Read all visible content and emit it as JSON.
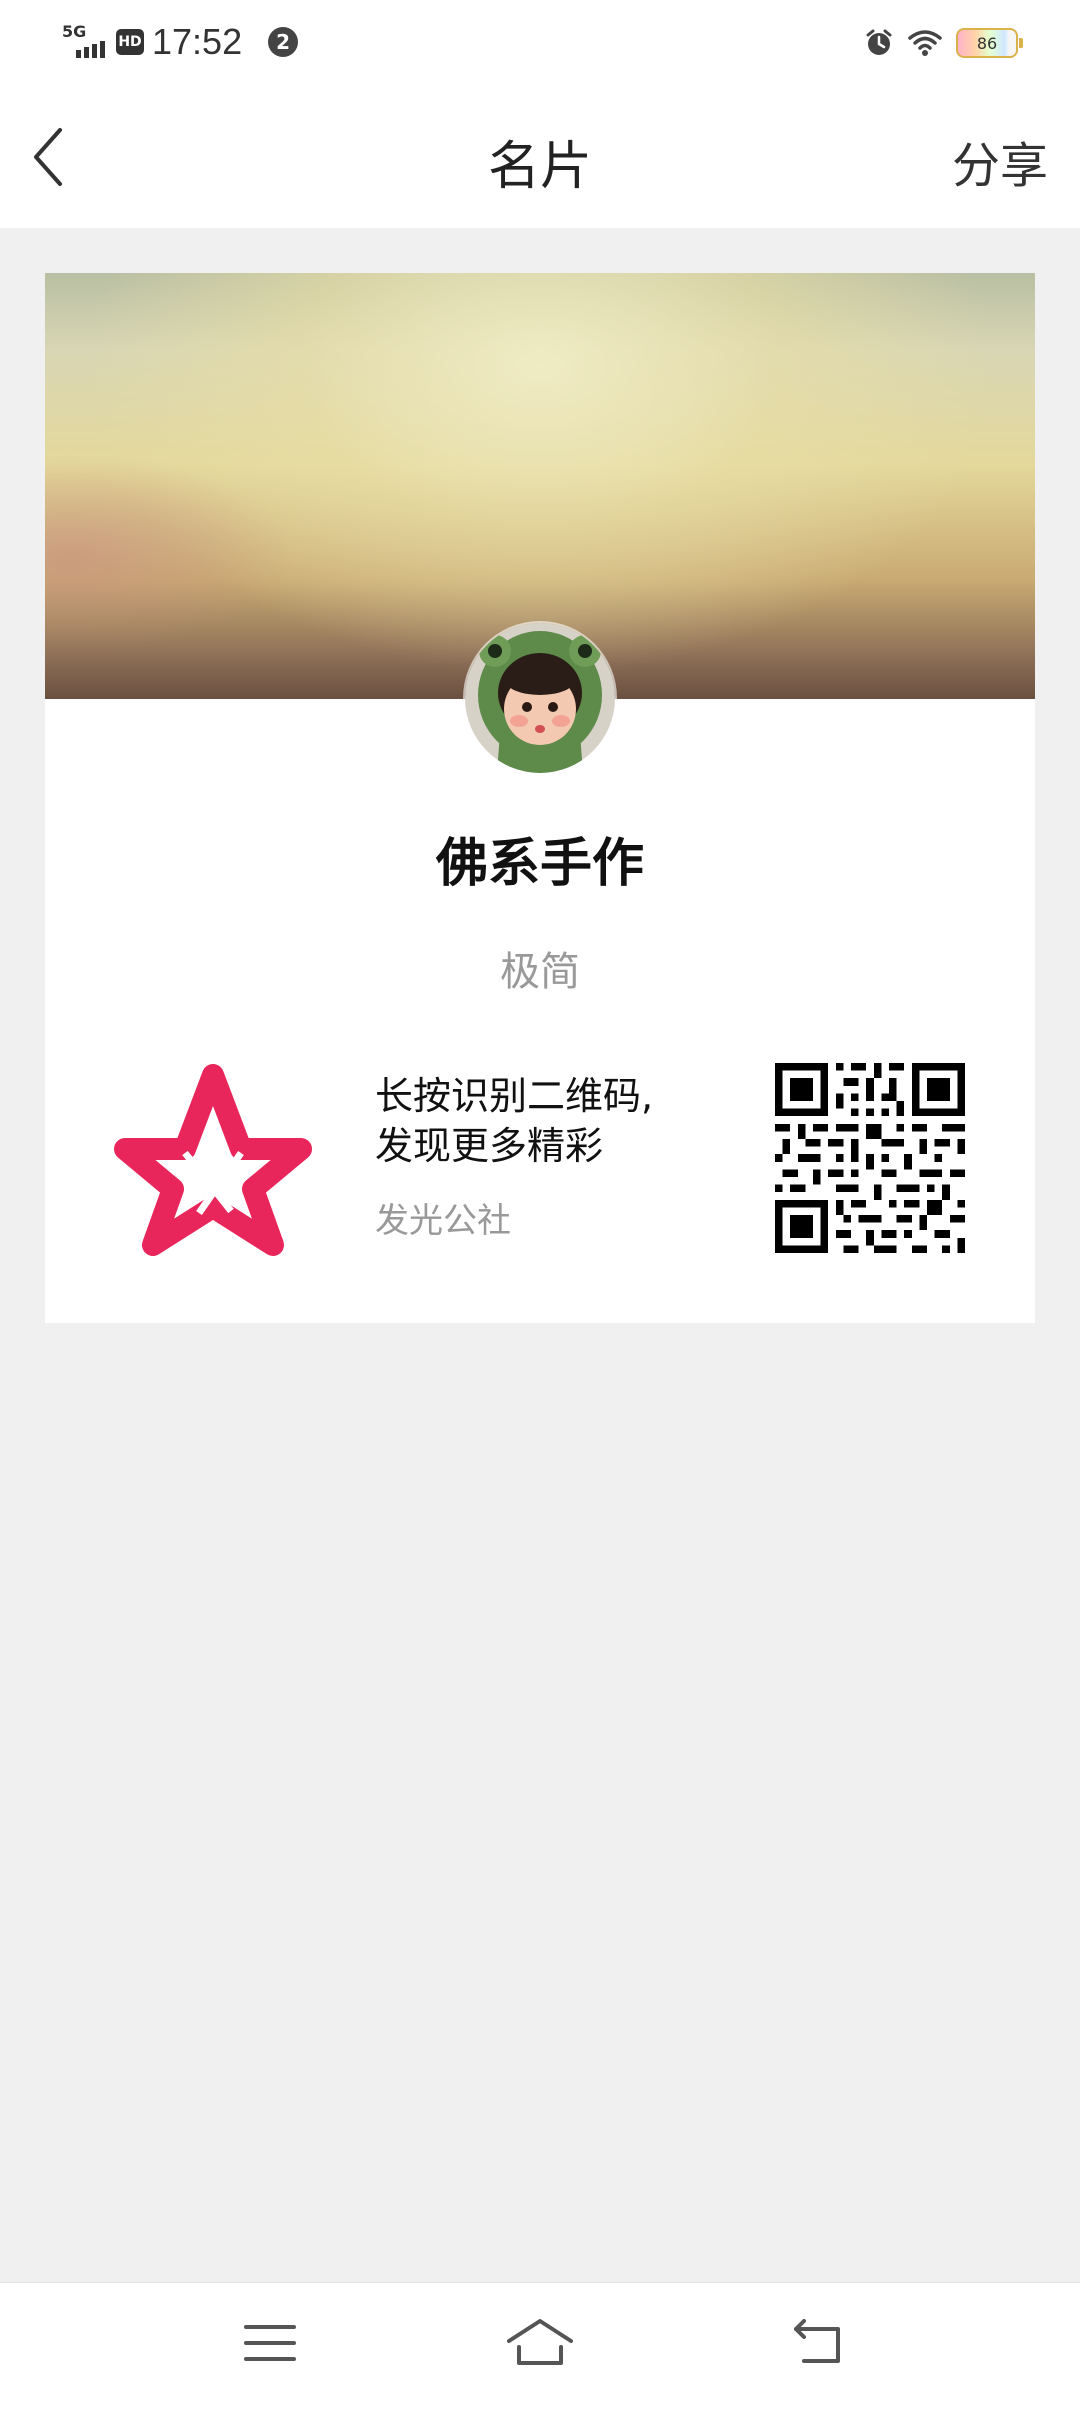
{
  "status_bar": {
    "network": "5G",
    "hd": "HD",
    "time": "17:52",
    "notification_count": "2",
    "battery": "86"
  },
  "header": {
    "title": "名片",
    "share_label": "分享"
  },
  "profile": {
    "name": "佛系手作",
    "signature": "极简"
  },
  "qr_section": {
    "line1": "长按识别二维码,",
    "line2": "发现更多精彩",
    "brand": "发光公社"
  },
  "colors": {
    "brand_star": "#e8265c",
    "page_bg": "#f0f0f0"
  },
  "icons": {
    "back": "chevron-left-icon",
    "menu": "menu-icon",
    "home": "home-icon",
    "return": "return-icon"
  }
}
